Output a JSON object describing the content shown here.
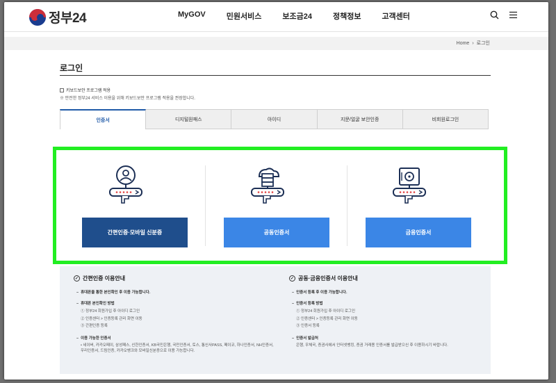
{
  "header": {
    "logo_text": "정부24",
    "nav": [
      "MyGOV",
      "민원서비스",
      "보조금24",
      "정책정보",
      "고객센터"
    ],
    "icons": [
      "search-icon",
      "menu-icon"
    ]
  },
  "breadcrumb": {
    "home": "Home",
    "separator": "›",
    "current": "로그인"
  },
  "page": {
    "title": "로그인",
    "keyboard_security_label": "키보드보안 프로그램 적용",
    "keyboard_security_note": "※ 안전한 정부24 서비스 이용을 위해 키보드보안 프로그램 적용을 권장합니다."
  },
  "tabs": [
    {
      "label": "인증서",
      "active": true
    },
    {
      "label": "디지털원패스",
      "active": false
    },
    {
      "label": "아이디",
      "active": false
    },
    {
      "label": "지문/얼굴 보안인증",
      "active": false
    },
    {
      "label": "비회원로그인",
      "active": false
    }
  ],
  "certs": {
    "simple": {
      "label": "간편인증·모바일 신분증",
      "icon": "user-key-icon",
      "color": "#1f4e8c"
    },
    "joint": {
      "label": "공동인증서",
      "icon": "cloud-server-key-icon",
      "color": "#3b86e6"
    },
    "financial": {
      "label": "금융인증서",
      "icon": "vault-key-icon",
      "color": "#3b86e6"
    },
    "highlight_color": "#22ee22"
  },
  "info": {
    "left": {
      "title": "간편인증 이용안내",
      "items": [
        {
          "text": "휴대폰을 통한 본인확인 후 이용 가능합니다."
        },
        {
          "text": "휴대폰 본인확인 방법"
        },
        {
          "text": "① 정부24 회원가입 후 아이디 로그인"
        },
        {
          "text": "② 인증센터 > 인증등록 관리 화면 이동"
        },
        {
          "text": "③ 간편인증 등록"
        },
        {
          "text": "이용 가능한 인증서"
        },
        {
          "text": "• 네이버, 카카오페이, 삼성패스, 신한인증서, KB국민은행, 국민인증서, 토스, 통신사PASS, 페이코, 하나인증서, NH인증서, 우리인증서, 드림인증, 카카오뱅크와 모바일신분증으로 이용 가능합니다."
        }
      ]
    },
    "right": {
      "title": "공동·금융인증서 이용안내",
      "items": [
        {
          "text": "인증서 등록 후 이용 가능합니다."
        },
        {
          "text": "인증서 등록 방법"
        },
        {
          "text": "① 정부24 회원가입 후 아이디 로그인"
        },
        {
          "text": "② 인증센터 > 인증등록 관리 화면 이동"
        },
        {
          "text": "③ 인증서 등록"
        },
        {
          "text": "인증서 발급처"
        },
        {
          "text": "은행, 우체국, 증권사에서 인터넷뱅킹, 증권 거래용 인증서를 발급받으신 후 이용하시기 바랍니다."
        }
      ]
    }
  }
}
